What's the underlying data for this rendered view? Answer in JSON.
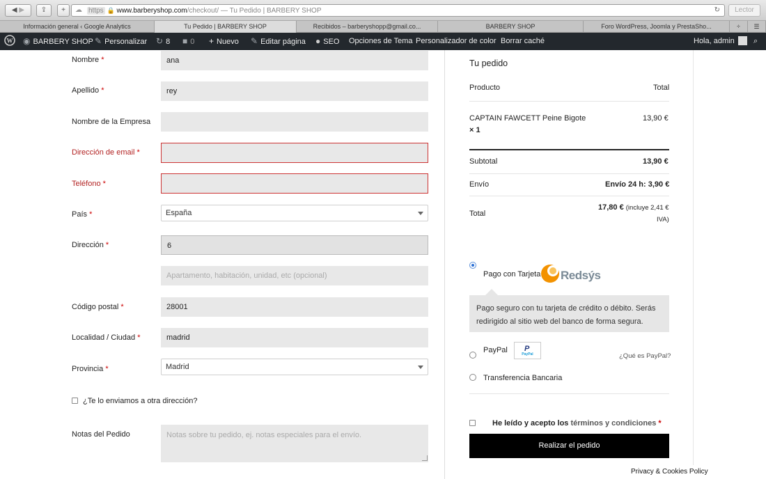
{
  "browser": {
    "url_scheme": "https",
    "url_host": "www.barberyshop.com",
    "url_path": "/checkout/ — Tu Pedido | BARBERY SHOP",
    "reader_label": "Lector",
    "tabs": [
      {
        "label": "Información general ‹ Google Analytics"
      },
      {
        "label": "Tu Pedido | BARBERY SHOP"
      },
      {
        "label": "Recibidos – barberyshopp@gmail.co..."
      },
      {
        "label": "BARBERY SHOP"
      },
      {
        "label": "Foro WordPress, Joomla y PrestaSho..."
      }
    ]
  },
  "adminbar": {
    "site_name": "BARBERY SHOP",
    "customize": "Personalizar",
    "updates_count": "8",
    "comments_count": "0",
    "new": "Nuevo",
    "edit_page": "Editar página",
    "seo": "SEO",
    "theme_options": "Opciones de Tema",
    "color_customizer": "Personalizador de color",
    "clear_cache": "Borrar caché",
    "greeting": "Hola, admin"
  },
  "form": {
    "first_name": {
      "label": "Nombre",
      "value": "ana"
    },
    "last_name": {
      "label": "Apellido",
      "value": "rey"
    },
    "company": {
      "label": "Nombre de la Empresa",
      "value": ""
    },
    "email": {
      "label": "Dirección de email",
      "value": ""
    },
    "phone": {
      "label": "Teléfono",
      "value": ""
    },
    "country": {
      "label": "País",
      "value": "España"
    },
    "address": {
      "label": "Dirección",
      "value": "6",
      "placeholder2": "Apartamento, habitación, unidad, etc (opcional)"
    },
    "postcode": {
      "label": "Código postal",
      "value": "28001"
    },
    "city": {
      "label": "Localidad / Ciudad",
      "value": "madrid"
    },
    "state": {
      "label": "Provincia",
      "value": "Madrid"
    },
    "ship_different": "¿Te lo enviamos a otra dirección?",
    "notes": {
      "label": "Notas del Pedido",
      "placeholder": "Notas sobre tu pedido, ej. notas especiales para el envío."
    },
    "required_mark": "*"
  },
  "order": {
    "title": "Tu pedido",
    "col_product": "Producto",
    "col_total": "Total",
    "item_name": "CAPTAIN FAWCETT Peine Bigote",
    "item_qty": "× 1",
    "item_total": "13,90 €",
    "subtotal_label": "Subtotal",
    "subtotal_value": "13,90 €",
    "shipping_label": "Envío",
    "shipping_value": "Envío 24 h: 3,90 €",
    "total_label": "Total",
    "total_value": "17,80 €",
    "total_tax_note_1": "(incluye 2,41 €",
    "total_tax_note_2": "IVA)"
  },
  "payment": {
    "card_label": "Pago con Tarjeta",
    "redsys_logo": "Redsýs",
    "card_description": "Pago seguro con tu tarjeta de crédito o débito. Serás redirigido al sitio web del banco de forma segura.",
    "paypal_label": "PayPal",
    "paypal_badge": "PayPal",
    "paypal_what": "¿Qué es PayPal?",
    "transfer_label": "Transferencia Bancaria",
    "terms_text": "He leído y acepto los",
    "terms_link": "términos y condiciones",
    "terms_req": "*",
    "submit_label": "Realizar el pedido"
  },
  "footer": {
    "privacy": "Privacy & Cookies Policy"
  },
  "colors": {
    "accent": "#2a6fd6",
    "error": "#b22222",
    "admin_bar": "#23282d",
    "redsys_orange": "#f39200"
  }
}
